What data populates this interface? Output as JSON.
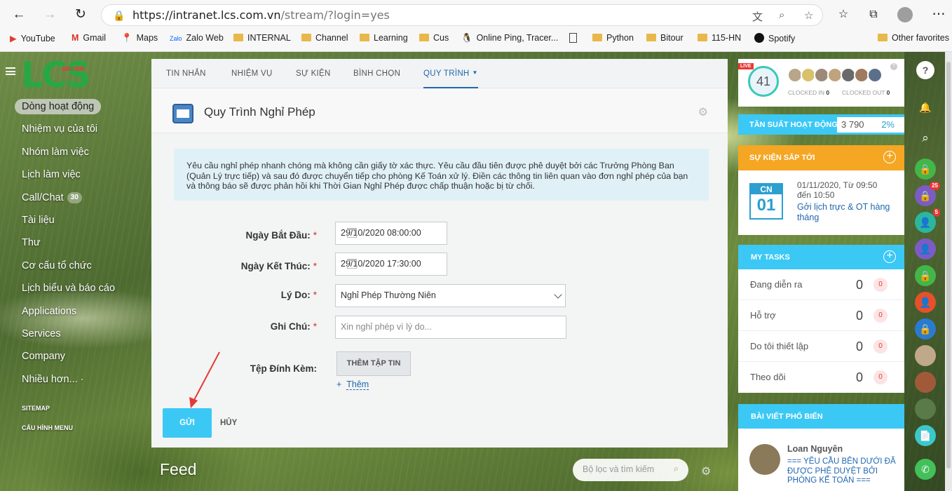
{
  "browser": {
    "url_main": "https://intranet.lcs.com.vn",
    "url_rest": "/stream/?login=yes",
    "bookmarks": [
      "YouTube",
      "Gmail",
      "Maps",
      "Zalo Web",
      "INTERNAL",
      "Channel",
      "Learning",
      "Cus",
      "Online Ping, Tracer...",
      "",
      "Python",
      "Bitour",
      "115-HN",
      "Spotify"
    ],
    "other_favorites": "Other favorites"
  },
  "sidebar": {
    "logo": "LCS",
    "logo_tag": "GROUP",
    "items": [
      {
        "label": "Dòng hoạt động"
      },
      {
        "label": "Nhiệm vụ của tôi"
      },
      {
        "label": "Nhóm làm việc"
      },
      {
        "label": "Lịch làm việc"
      },
      {
        "label": "Call/Chat",
        "count": "30"
      },
      {
        "label": "Tài liệu"
      },
      {
        "label": "Thư"
      },
      {
        "label": "Cơ cấu tổ chức"
      },
      {
        "label": "Lịch biểu và báo cáo"
      },
      {
        "label": "Applications"
      },
      {
        "label": "Services"
      },
      {
        "label": "Company"
      },
      {
        "label": "Nhiều hơn... ·"
      }
    ],
    "sitemap": "SITEMAP",
    "config_menu": "CẤU HÌNH MENU"
  },
  "tabs": [
    "TIN NHẮN",
    "NHIỆM VỤ",
    "SỰ KIỆN",
    "BÌNH CHỌN",
    "QUY TRÌNH"
  ],
  "form": {
    "title": "Quy Trình Nghỉ Phép",
    "info": "Yêu cầu nghỉ phép nhanh chóng mà không cần giấy tờ xác thực. Yêu cầu đầu tiên được phê duyệt bởi các Trưởng Phòng Ban (Quản Lý trực tiếp) và sau đó được chuyển tiếp cho phòng Kế Toán xử lý. Điền các thông tin liên quan vào đơn nghỉ phép của bạn và thông báo sẽ được phản hồi khi Thời Gian Nghỉ Phép được chấp thuận hoặc bị từ chối.",
    "start_label": "Ngày Bắt Đầu:",
    "start_value": "29/10/2020 08:00:00",
    "end_label": "Ngày Kết Thúc:",
    "end_value": "29/10/2020 17:30:00",
    "reason_label": "Lý Do:",
    "reason_value": "Nghỉ Phép Thường Niên",
    "note_label": "Ghi Chú:",
    "note_placeholder": "Xin nghỉ phép vì lý do...",
    "attach_label": "Tệp Đính Kèm:",
    "attach_button": "THÊM TẬP TIN",
    "add_more": "Thêm",
    "required": "*",
    "send": "GỬI",
    "cancel": "HỦY"
  },
  "feed": {
    "title": "Feed",
    "search_placeholder": "Bộ lọc và tìm kiếm"
  },
  "right": {
    "live": "LIVE",
    "online": "41",
    "clocked_in": "CLOCKED IN",
    "clocked_in_n": "0",
    "clocked_out": "CLOCKED OUT",
    "clocked_out_n": "0",
    "freq_label": "TẦN SUẤT HOẠT ĐỘNG",
    "freq_value": "3 790",
    "freq_pct": "2%",
    "events_title": "SỰ KIỆN SẮP TỚI",
    "event_day": "CN",
    "event_date": "01",
    "event_time1": "01/11/2020, Từ 09:50",
    "event_time2": "đến 10:50",
    "event_link": "Gởi lịch trực & OT hàng tháng",
    "tasks_title": "MY TASKS",
    "tasks": [
      {
        "label": "Đang diễn ra",
        "value": "0",
        "badge": "0"
      },
      {
        "label": "Hỗ trợ",
        "value": "0",
        "badge": "0"
      },
      {
        "label": "Do tôi thiết lập",
        "value": "0",
        "badge": "0"
      },
      {
        "label": "Theo dõi",
        "value": "0",
        "badge": "0"
      }
    ],
    "popular_title": "BÀI VIẾT PHỔ BIẾN",
    "popular_author": "Loan Nguyên",
    "popular_text": "=== YÊU CẦU BÊN DƯỚI ĐÃ ĐƯỢC PHÊ DUYỆT BỞI PHÒNG KẾ TOÁN ==="
  },
  "iconbar": {
    "badge1": "25",
    "badge2": "5"
  },
  "colors": {
    "accent": "#3bc8f5",
    "link": "#2067b0",
    "event": "#f5a623",
    "logo": "#27a844"
  }
}
